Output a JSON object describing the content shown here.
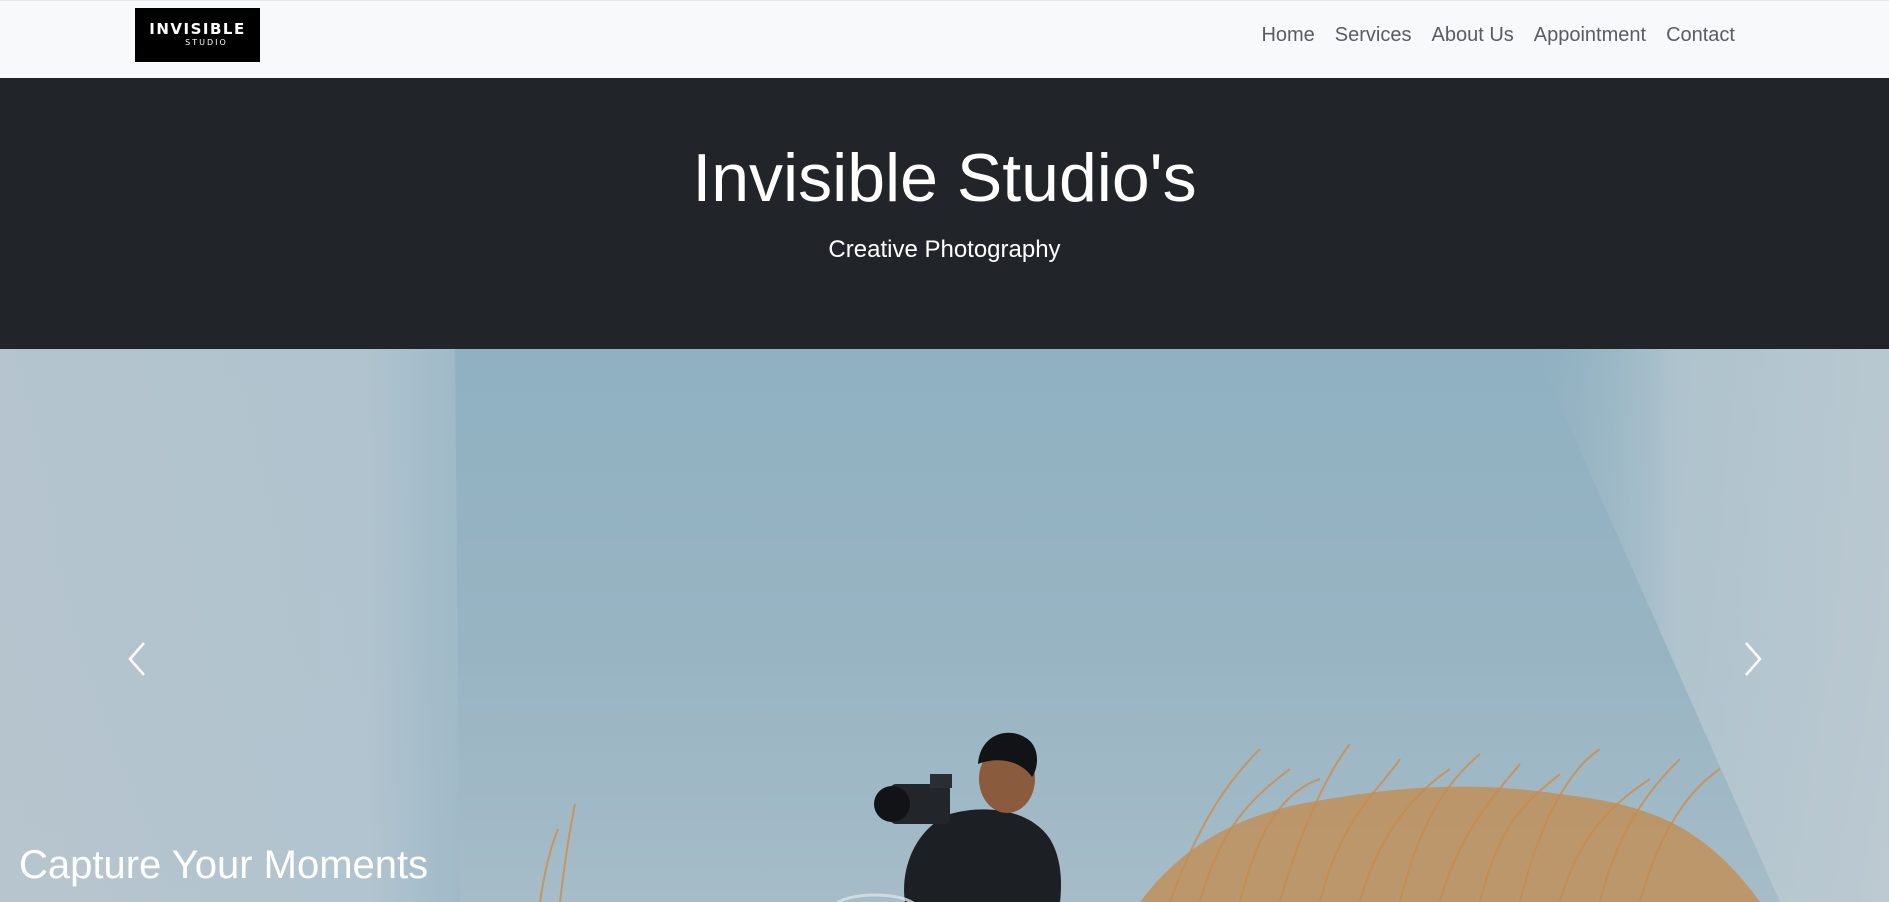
{
  "brand": {
    "logo_line1": "INVISIBLE",
    "logo_line2": "STUDIO"
  },
  "nav": {
    "items": [
      {
        "label": "Home"
      },
      {
        "label": "Services"
      },
      {
        "label": "About Us"
      },
      {
        "label": "Appointment"
      },
      {
        "label": "Contact"
      }
    ]
  },
  "hero": {
    "title": "Invisible Studio's",
    "subtitle": "Creative Photography"
  },
  "carousel": {
    "caption": "Capture Your Moments",
    "prev_icon": "chevron-left-icon",
    "next_icon": "chevron-right-icon"
  },
  "colors": {
    "navbar_bg": "#f8f9fa",
    "hero_bg": "#212529",
    "nav_text": "#595c60",
    "sky": "#92b2c2",
    "grass": "#c08a4a"
  }
}
